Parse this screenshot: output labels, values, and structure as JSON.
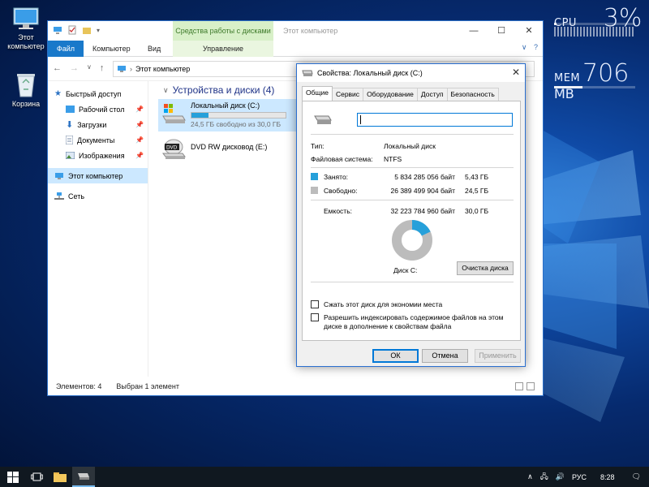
{
  "desktop": {
    "icons": [
      {
        "label": "Этот компьютер",
        "icon": "computer-icon"
      },
      {
        "label": "Корзина",
        "icon": "recycle-bin-icon"
      }
    ]
  },
  "monitor": {
    "cpu_label": "CPU",
    "cpu_value": "3%",
    "cpu_fraction": 0.03,
    "mem_label": "MEM",
    "mem_value": "706",
    "mem_unit": "MB",
    "mem_fraction": 0.35
  },
  "explorer": {
    "title": "Этот компьютер",
    "context_tab": "Средства работы с дисками",
    "ribbon_tabs": {
      "file": "Файл",
      "computer": "Компьютер",
      "view": "Вид",
      "manage": "Управление"
    },
    "breadcrumb": "Этот компьютер",
    "nav": {
      "quick_access": "Быстрый доступ",
      "desktop": "Рабочий стол",
      "downloads": "Загрузки",
      "documents": "Документы",
      "pictures": "Изображения",
      "this_pc": "Этот компьютер",
      "network": "Сеть"
    },
    "group_header": "Устройства и диски (4)",
    "drives": [
      {
        "name": "Локальный диск (C:)",
        "detail": "24,5 ГБ свободно из 30,0 ГБ",
        "used_fraction": 0.18
      },
      {
        "name": "DVD RW дисковод (E:)",
        "detail": ""
      }
    ],
    "status": {
      "items": "Элементов: 4",
      "selected": "Выбран 1 элемент"
    }
  },
  "dialog": {
    "title": "Свойства: Локальный диск (C:)",
    "tabs": [
      "Общие",
      "Сервис",
      "Оборудование",
      "Доступ",
      "Безопасность"
    ],
    "name_value": "",
    "type_label": "Тип:",
    "type_value": "Локальный диск",
    "fs_label": "Файловая система:",
    "fs_value": "NTFS",
    "used_label": "Занято:",
    "used_bytes": "5 834 285 056 байт",
    "used_gb": "5,43 ГБ",
    "free_label": "Свободно:",
    "free_bytes": "26 389 499 904 байт",
    "free_gb": "24,5 ГБ",
    "capacity_label": "Емкость:",
    "capacity_bytes": "32 223 784 960 байт",
    "capacity_gb": "30,0 ГБ",
    "used_fraction": 0.18,
    "disk_label": "Диск C:",
    "cleanup_button": "Очистка диска",
    "compress_label": "Сжать этот диск для экономии места",
    "index_label": "Разрешить индексировать содержимое файлов на этом диске в дополнение к свойствам файла",
    "ok": "ОК",
    "cancel": "Отмена",
    "apply": "Применить",
    "colors": {
      "used": "#26a0da",
      "free": "#bcbcbc"
    }
  },
  "taskbar": {
    "lang": "РУС",
    "time": "8:28"
  }
}
